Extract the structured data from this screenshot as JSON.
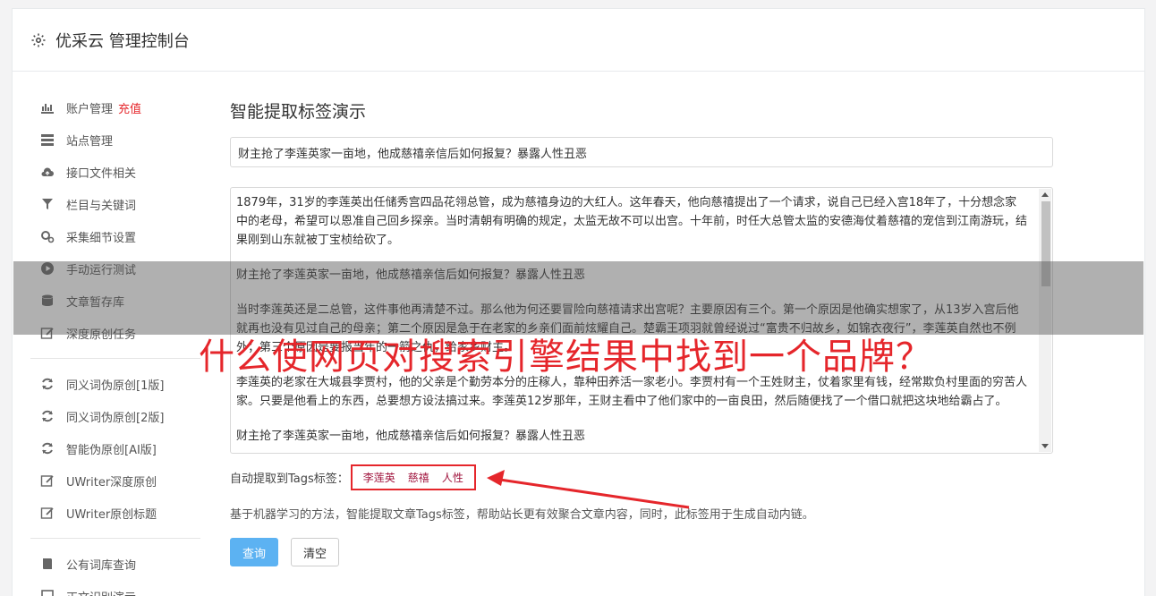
{
  "header": {
    "title": "优采云 管理控制台"
  },
  "sidebar": {
    "items": [
      {
        "label": "账户管理",
        "extra": "充值",
        "icon": "bar-chart-icon"
      },
      {
        "label": "站点管理",
        "icon": "server-icon"
      },
      {
        "label": "接口文件相关",
        "icon": "cloud-upload-icon"
      },
      {
        "label": "栏目与关键词",
        "icon": "filter-icon"
      },
      {
        "label": "采集细节设置",
        "icon": "gears-icon"
      },
      {
        "label": "手动运行测试",
        "icon": "play-icon"
      },
      {
        "label": "文章暂存库",
        "icon": "database-icon"
      },
      {
        "label": "深度原创任务",
        "icon": "edit-icon"
      }
    ],
    "items2": [
      {
        "label": "同义词伪原创[1版]",
        "icon": "refresh-icon"
      },
      {
        "label": "同义词伪原创[2版]",
        "icon": "refresh-icon"
      },
      {
        "label": "智能伪原创[AI版]",
        "icon": "refresh-icon"
      },
      {
        "label": "UWriter深度原创",
        "icon": "edit-icon"
      },
      {
        "label": "UWriter原创标题",
        "icon": "edit-icon"
      }
    ],
    "items3": [
      {
        "label": "公有词库查询",
        "icon": "book-icon"
      },
      {
        "label": "正文识别演示",
        "icon": "square-icon"
      }
    ]
  },
  "main": {
    "heading": "智能提取标签演示",
    "title_value": "财主抢了李莲英家一亩地，他成慈禧亲信后如何报复？暴露人性丑恶",
    "paragraphs": [
      "1879年，31岁的李莲英出任储秀宫四品花翎总管，成为慈禧身边的大红人。这年春天，他向慈禧提出了一个请求，说自己已经入宫18年了，十分想念家中的老母，希望可以恩准自己回乡探亲。当时清朝有明确的规定，太监无故不可以出宫。十年前，时任大总管太监的安德海仗着慈禧的宠信到江南游玩，结果刚到山东就被丁宝桢给砍了。",
      "财主抢了李莲英家一亩地，他成慈禧亲信后如何报复？暴露人性丑恶",
      "当时李莲英还是二总管，这件事他再清楚不过。那么他为何还要冒险向慈禧请求出宫呢？主要原因有三个。第一个原因是他确实想家了，从13岁入宫后他就再也没有见过自己的母亲；第二个原因是急于在老家的乡亲们面前炫耀自己。楚霸王项羽就曾经说过“富贵不归故乡，如锦衣夜行”，李莲英自然也不例外；第三个原因是要报当年的一箭之仇，给家乡财主。",
      "李莲英的老家在大城县李贾村，他的父亲是个勤劳本分的庄稼人，靠种田养活一家老小。李贾村有一个王姓财主，仗着家里有钱，经常欺负村里面的穷苦人家。只要是他看上的东西，总要想方设法搞过来。李莲英12岁那年，王财主看中了他们家中的一亩良田，然后随便找了一个借口就把这块地给霸占了。",
      "财主抢了李莲英家一亩地，他成慈禧亲信后如何报复？暴露人性丑恶"
    ],
    "tags_label": "自动提取到Tags标签：",
    "tags": [
      "李莲英",
      "慈禧",
      "人性"
    ],
    "description": "基于机器学习的方法，智能提取文章Tags标签，帮助站长更有效聚合文章内容，同时，此标签用于生成自动内链。",
    "query_button": "查询",
    "clear_button": "清空"
  },
  "overlay": {
    "caption": "什么使网页对搜索引擎结果中找到一个品牌？"
  },
  "colors": {
    "accent": "#5cb2f2",
    "highlight": "#e5262b",
    "tag": "#a0153e"
  }
}
